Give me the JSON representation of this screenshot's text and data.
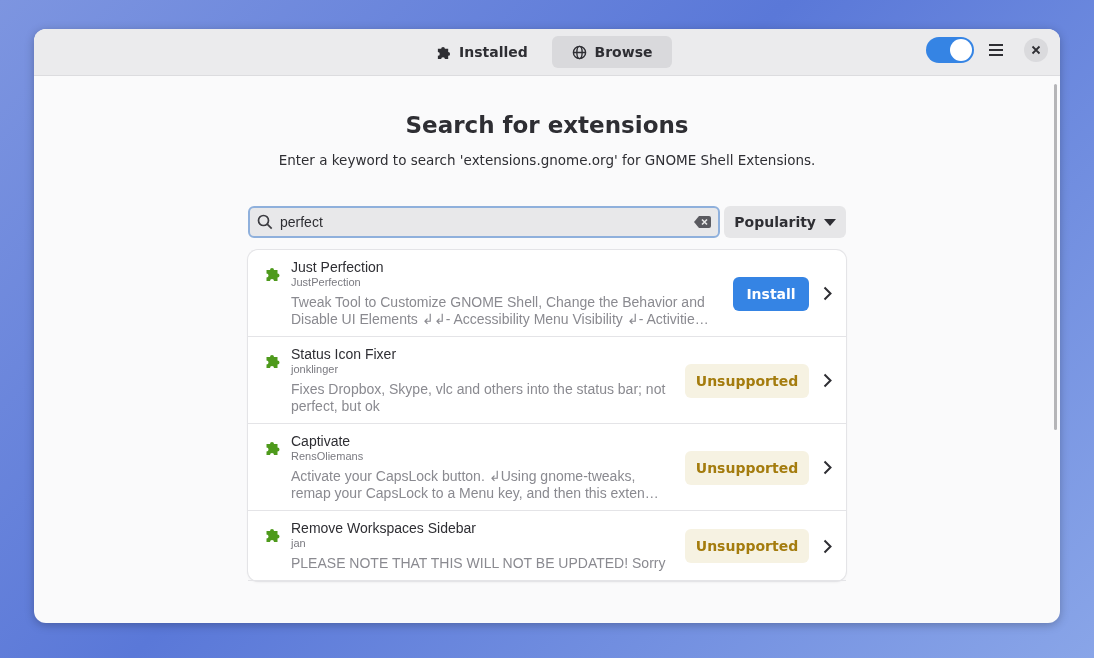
{
  "header": {
    "tabs": [
      {
        "label": "Installed",
        "selected": false
      },
      {
        "label": "Browse",
        "selected": true
      }
    ],
    "toggle": {
      "on": true
    }
  },
  "title": "Search for extensions",
  "subtitle": "Enter a keyword to search 'extensions.gnome.org' for GNOME Shell Extensions.",
  "search": {
    "value": "perfect"
  },
  "sort": {
    "label": "Popularity"
  },
  "results": [
    {
      "name": "Just Perfection",
      "author": "JustPerfection",
      "description": "Tweak Tool to Customize GNOME Shell, Change the Behavior and Disable UI Elements ↲↲- Accessibility Menu Visibility ↲- Activitie…",
      "action": {
        "kind": "install",
        "label": "Install"
      }
    },
    {
      "name": "Status Icon Fixer",
      "author": "jonklinger",
      "description": "Fixes Dropbox, Skype, vlc and others into the status bar; not perfect, but ok",
      "action": {
        "kind": "unsupported",
        "label": "Unsupported"
      }
    },
    {
      "name": "Captivate",
      "author": "RensOliemans",
      "description": "Activate your CapsLock button. ↲Using gnome-tweaks, remap your CapsLock to a Menu key, and then this exten…",
      "action": {
        "kind": "unsupported",
        "label": "Unsupported"
      }
    },
    {
      "name": "Remove Workspaces Sidebar",
      "author": "jan",
      "description": "PLEASE NOTE THAT THIS WILL NOT BE UPDATED! Sorry",
      "action": {
        "kind": "unsupported",
        "label": "Unsupported"
      }
    }
  ]
}
